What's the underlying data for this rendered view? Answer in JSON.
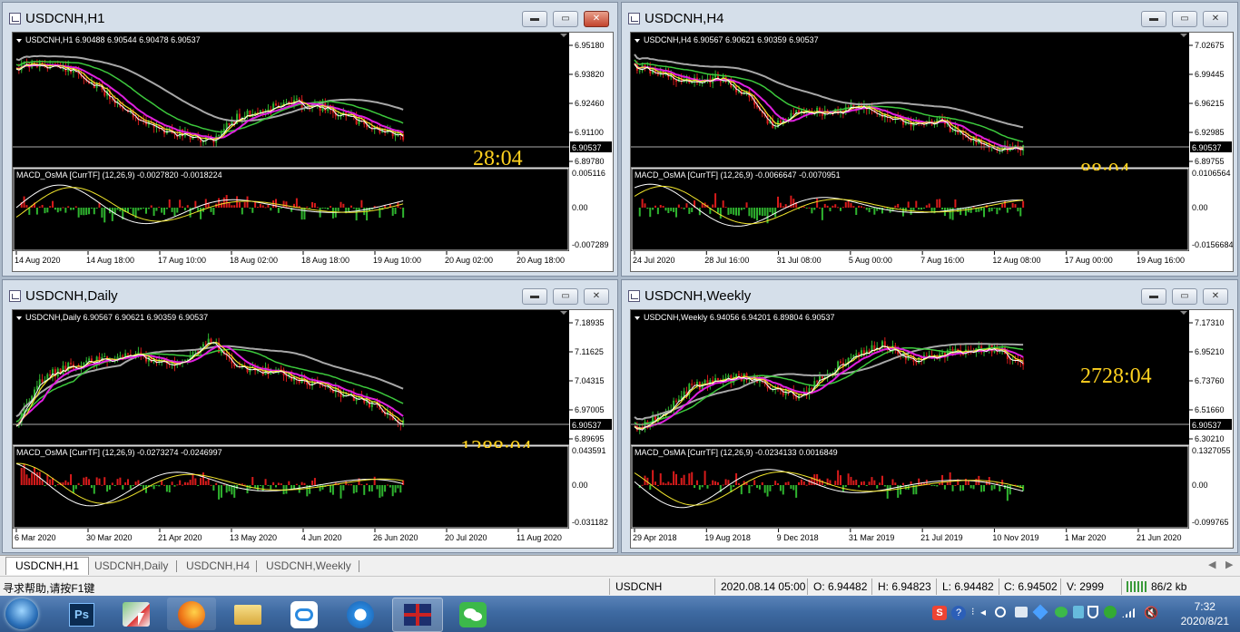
{
  "windows": [
    {
      "id": "h1",
      "title": "USDCNH,H1",
      "info": "USDCNH,H1  6.90488 6.90544 6.90478 6.90537",
      "price_levels": [
        "6.95180",
        "6.93820",
        "6.92460",
        "6.91100",
        "6.89780"
      ],
      "current_price": "6.90537",
      "countdown": "28:04",
      "macd_label": "MACD_OsMA [CurrTF] (12,26,9) -0.0027820 -0.0018224",
      "macd_levels": [
        "0.005116",
        "0.00",
        "-0.007289"
      ],
      "time_labels": [
        "14 Aug 2020",
        "14 Aug 18:00",
        "17 Aug 10:00",
        "18 Aug 02:00",
        "18 Aug 18:00",
        "19 Aug 10:00",
        "20 Aug 02:00",
        "20 Aug 18:00"
      ],
      "closeRed": true
    },
    {
      "id": "h4",
      "title": "USDCNH,H4",
      "info": "USDCNH,H4  6.90567 6.90621 6.90359 6.90537",
      "price_levels": [
        "7.02675",
        "6.99445",
        "6.96215",
        "6.92985",
        "6.89755"
      ],
      "current_price": "6.90537",
      "countdown": "88:04",
      "macd_label": "MACD_OsMA [CurrTF] (12,26,9) -0.0066647 -0.0070951",
      "macd_levels": [
        "0.0106564",
        "0.00",
        "-0.0156684"
      ],
      "time_labels": [
        "24 Jul 2020",
        "28 Jul 16:00",
        "31 Jul 08:00",
        "5 Aug 00:00",
        "7 Aug 16:00",
        "12 Aug 08:00",
        "17 Aug 00:00",
        "19 Aug 16:00"
      ],
      "closeRed": false
    },
    {
      "id": "daily",
      "title": "USDCNH,Daily",
      "info": "USDCNH,Daily  6.90567 6.90621 6.90359 6.90537",
      "price_levels": [
        "7.18935",
        "7.11625",
        "7.04315",
        "6.97005",
        "6.89695"
      ],
      "current_price": "6.90537",
      "countdown": "1288:04",
      "macd_label": "MACD_OsMA [CurrTF] (12,26,9) -0.0273274 -0.0246997",
      "macd_levels": [
        "0.043591",
        "0.00",
        "-0.031182"
      ],
      "time_labels": [
        "6 Mar 2020",
        "30 Mar 2020",
        "21 Apr 2020",
        "13 May 2020",
        "4 Jun 2020",
        "26 Jun 2020",
        "20 Jul 2020",
        "11 Aug 2020"
      ],
      "closeRed": false
    },
    {
      "id": "weekly",
      "title": "USDCNH,Weekly",
      "info": "USDCNH,Weekly  6.94056 6.94201 6.89804 6.90537",
      "price_levels": [
        "7.17310",
        "6.95210",
        "6.73760",
        "6.51660",
        "6.30210"
      ],
      "current_price": "6.90537",
      "countdown": "2728:04",
      "macd_label": "MACD_OsMA [CurrTF] (12,26,9) -0.0234133 0.0016849",
      "macd_levels": [
        "0.1327055",
        "0.00",
        "-0.099765"
      ],
      "time_labels": [
        "29 Apr 2018",
        "19 Aug 2018",
        "9 Dec 2018",
        "31 Mar 2019",
        "21 Jul 2019",
        "10 Nov 2019",
        "1 Mar 2020",
        "21 Jun 2020"
      ],
      "closeRed": false
    }
  ],
  "window_buttons": {
    "minimize": "▬",
    "maximize": "▭",
    "close": "✕"
  },
  "tabs": [
    "USDCNH,H1",
    "USDCNH,Daily",
    "USDCNH,H4",
    "USDCNH,Weekly"
  ],
  "status": {
    "help": "寻求帮助,请按F1键",
    "symbol": "USDCNH",
    "datetime": "2020.08.14 05:00",
    "open": "O: 6.94482",
    "high": "H: 6.94823",
    "low": "L: 6.94482",
    "close": "C: 6.94502",
    "volume": "V: 2999",
    "traffic": "86/2 kb"
  },
  "taskbar": {
    "apps": [
      "start-orb",
      "photoshop",
      "paint",
      "firefox",
      "explorer",
      "baidu-netdisk",
      "qq-browser",
      "mt4",
      "wechat"
    ],
    "time": "7:32",
    "date": "2020/8/21"
  },
  "colors": {
    "chart_bg": "#000000",
    "bull": "#2fb52f",
    "bear": "#d81b1b",
    "ma_magenta": "#e020e0",
    "ma_yellow": "#f2e62c",
    "ma_green": "#3cc83c",
    "ma_gray": "#a8a8a8",
    "countdown": "#ffd21f"
  }
}
